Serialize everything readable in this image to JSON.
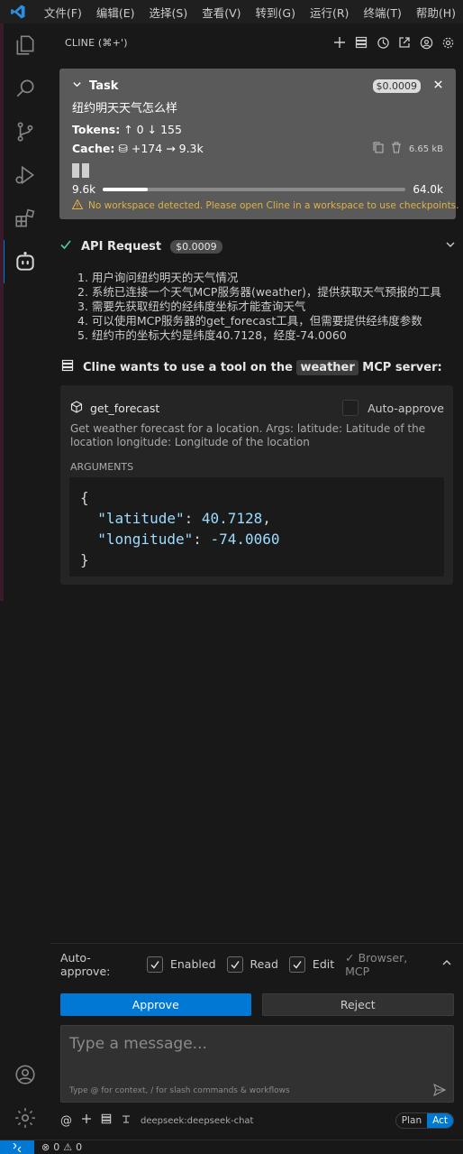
{
  "menu": [
    "文件(F)",
    "编辑(E)",
    "选择(S)",
    "查看(V)",
    "转到(G)",
    "运行(R)",
    "终端(T)",
    "帮助(H)"
  ],
  "sidebar": {
    "title": "CLINE (⌘+')"
  },
  "task": {
    "title": "Task",
    "cost": "$0.0009",
    "question": "纽约明天天气怎么样",
    "tokens_label": "Tokens:",
    "tokens_in": "↑ 0",
    "tokens_out": "↓ 155",
    "cache_label": "Cache:",
    "cache_write": "+174",
    "cache_read": "→ 9.3k",
    "size": "6.65 kB",
    "context_used": "9.6k",
    "context_max": "64.0k",
    "context_fraction": 0.15,
    "warning": "No workspace detected. Please open Cline in a workspace to use checkpoints."
  },
  "api_request": {
    "label": "API Request",
    "cost": "$0.0009"
  },
  "reasoning": [
    "1. 用户询问纽约明天的天气情况",
    "2. 系统已连接一个天气MCP服务器(weather)，提供获取天气预报的工具",
    "3. 需要先获取纽约的经纬度坐标才能查询天气",
    "4. 可以使用MCP服务器的get_forecast工具，但需要提供经纬度参数",
    "5. 纽约市的坐标大约是纬度40.7128，经度-74.0060"
  ],
  "tool": {
    "heading_pre": "Cline wants to use a tool on the",
    "server": "weather",
    "heading_post": "MCP server:",
    "name": "get_forecast",
    "auto_approve": "Auto-approve",
    "description": "Get weather forecast for a location. Args: latitude: Latitude of the location longitude: Longitude of the location",
    "args_label": "ARGUMENTS",
    "code_open": "{",
    "code_close": "}",
    "lat_key": "\"latitude\"",
    "lat_val": "40.7128",
    "lon_key": "\"longitude\"",
    "lon_val": "-74.0060"
  },
  "auto_approve_bar": {
    "label": "Auto-approve:",
    "enabled": "Enabled",
    "read": "Read",
    "edit": "Edit",
    "more": "✓ Browser, MCP"
  },
  "buttons": {
    "approve": "Approve",
    "reject": "Reject"
  },
  "input": {
    "placeholder": "Type a message...",
    "hint": "Type @ for context, / for slash commands & workflows"
  },
  "footer": {
    "model": "deepseek:deepseek-chat",
    "plan": "Plan",
    "act": "Act"
  },
  "status": {
    "errors": "0",
    "warnings": "0"
  },
  "colors": {
    "accent": "#0078d4",
    "warning": "#e0b341",
    "success": "#4ec9b0"
  }
}
